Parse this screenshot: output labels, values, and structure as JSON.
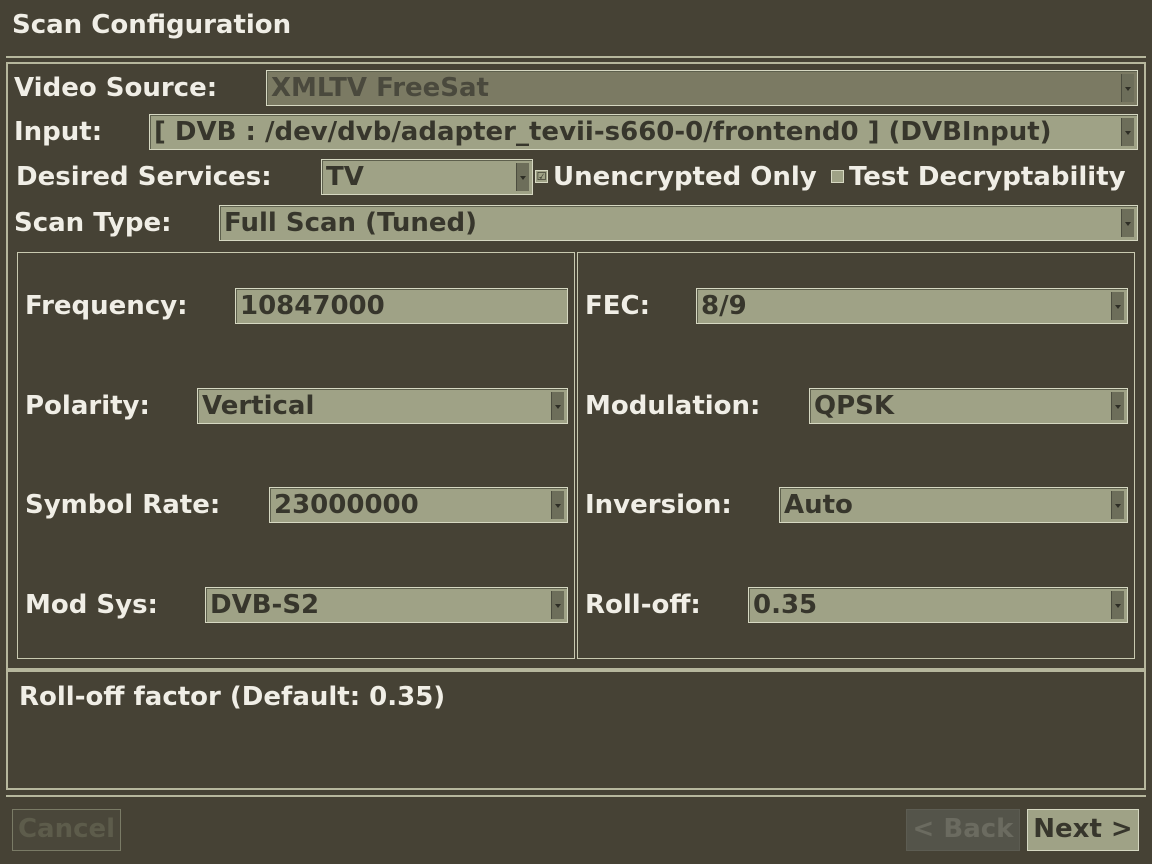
{
  "window": {
    "title": "Scan Configuration"
  },
  "form": {
    "video_source": {
      "label": "Video Source:",
      "value": "XMLTV FreeSat"
    },
    "input": {
      "label": "Input:",
      "value": "[ DVB : /dev/dvb/adapter_tevii-s660-0/frontend0 ] (DVBInput)"
    },
    "desired_services": {
      "label": "Desired Services:",
      "value": "TV",
      "unencrypted_only": {
        "label": "Unencrypted Only",
        "checked": true,
        "mark": "☑"
      },
      "test_decryptability": {
        "label": "Test Decryptability",
        "checked": false,
        "mark": ""
      }
    },
    "scan_type": {
      "label": "Scan Type:",
      "value": "Full Scan (Tuned)"
    }
  },
  "tuning": {
    "frequency": {
      "label": "Frequency:",
      "value": "10847000"
    },
    "polarity": {
      "label": "Polarity:",
      "value": "Vertical"
    },
    "symbol_rate": {
      "label": "Symbol Rate:",
      "value": "23000000"
    },
    "mod_sys": {
      "label": "Mod Sys:",
      "value": "DVB-S2"
    },
    "fec": {
      "label": "FEC:",
      "value": "8/9"
    },
    "modulation": {
      "label": "Modulation:",
      "value": "QPSK"
    },
    "inversion": {
      "label": "Inversion:",
      "value": "Auto"
    },
    "rolloff": {
      "label": "Roll-off:",
      "value": "0.35"
    }
  },
  "help": {
    "text": "Roll-off factor (Default: 0.35)"
  },
  "buttons": {
    "cancel": "Cancel",
    "back": "< Back",
    "next": "Next >"
  },
  "colors": {
    "background": "#464235",
    "widget": "#9fa286",
    "border": "#b6b79d"
  }
}
